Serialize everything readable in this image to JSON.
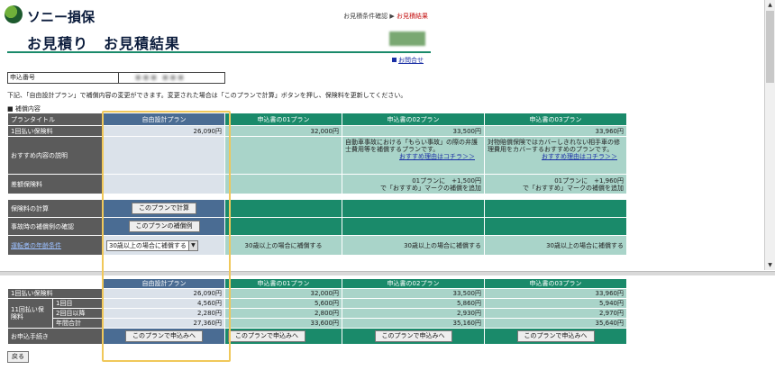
{
  "header": {
    "brand": "ソニー損保",
    "steps": [
      "お見積条件確認",
      "▶",
      "お見積結果"
    ]
  },
  "page_title": "お見積り　お見積結果",
  "contact_link": "お問合せ",
  "application_no": {
    "label": "申込番号",
    "value": "■■■ ■■■"
  },
  "notice": "下記、「自由設計プラン」で補償内容の変更ができます。変更された場合は「このプランで計算」ボタンを押し、保険料を更新してください。",
  "section_title": "■ 補償内容",
  "top_table": {
    "row_headers": [
      "プランタイトル",
      "1回払い保険料",
      "おすすめ内容の説明",
      "差額保険料",
      "保険料の計算",
      "事故時の補償例の確認",
      "運転者の年齢条件"
    ],
    "plans": [
      "自由設計プラン",
      "申込書の01プラン",
      "申込書の02プラン",
      "申込書の03プラン"
    ],
    "premiums": [
      "26,090円",
      "32,000円",
      "33,500円",
      "33,960円"
    ],
    "desc_02": "自動車事故における「もらい事故」の際の弁護士費用等を補償するプランです。",
    "desc_03": "対物賠償保険ではカバーしきれない相手車の修理費用をカバーするおすすめのプランです。",
    "reason_link": "おすすめ理由はコチラ＞＞",
    "diff_02": [
      "01プランに　+1,500円",
      "で「おすすめ」マークの補償を追加"
    ],
    "diff_03": [
      "01プランに　+1,960円",
      "で「おすすめ」マークの補償を追加"
    ],
    "calc_button": "このプランで計算",
    "example_button": "このプランの補償例",
    "age_select": "30歳以上の場合に補償する",
    "age_values": [
      "30歳以上の場合に補償する",
      "30歳以上の場合に補償する",
      "30歳以上の場合に補償する"
    ]
  },
  "bottom_table": {
    "plans": [
      "自由設計プラン",
      "申込書の01プラン",
      "申込書の02プラン",
      "申込書の03プラン"
    ],
    "row_once": "1回払い保険料",
    "row_11": "11回払い保険料",
    "sub_first": "1回目",
    "sub_second": "2回目以降",
    "sub_total": "年間合計",
    "row_apply": "お申込手続き",
    "once": [
      "26,090円",
      "32,000円",
      "33,500円",
      "33,960円"
    ],
    "first": [
      "4,560円",
      "5,600円",
      "5,860円",
      "5,940円"
    ],
    "second": [
      "2,280円",
      "2,800円",
      "2,930円",
      "2,970円"
    ],
    "total": [
      "27,360円",
      "33,600円",
      "35,160円",
      "35,640円"
    ],
    "apply_button": "このプランで申込みへ"
  },
  "back_button": "戻る",
  "colors": {
    "navy": "#0b1c3c",
    "green": "#1a8a6a",
    "blue_header": "#4a6c93",
    "highlight": "#f0c85a"
  }
}
